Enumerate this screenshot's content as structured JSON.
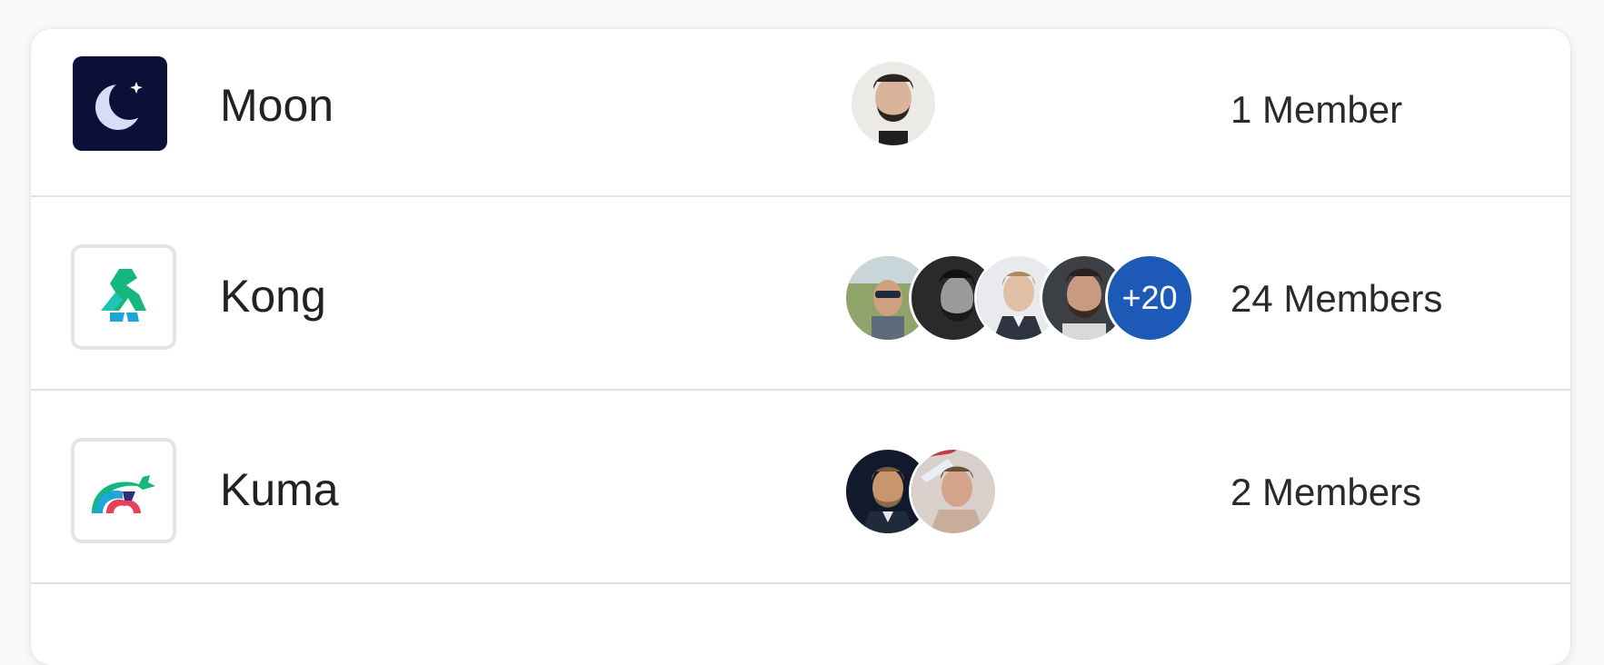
{
  "teams": [
    {
      "name": "Moon",
      "logo_icon": "moon-logo-icon",
      "member_count_label": "1 Member",
      "avatars": [
        "member-avatar"
      ],
      "extra_label": ""
    },
    {
      "name": "Kong",
      "logo_icon": "kong-logo-icon",
      "member_count_label": "24 Members",
      "avatars": [
        "member-avatar",
        "member-avatar",
        "member-avatar",
        "member-avatar"
      ],
      "extra_label": "+20"
    },
    {
      "name": "Kuma",
      "logo_icon": "kuma-logo-icon",
      "member_count_label": "2 Members",
      "avatars": [
        "member-avatar",
        "member-avatar"
      ],
      "extra_label": ""
    }
  ],
  "colors": {
    "more_badge": "#1d5ab8",
    "moon_bg": "#0b1038",
    "kong_green": "#15b77e",
    "kong_teal": "#1fc3b8"
  }
}
